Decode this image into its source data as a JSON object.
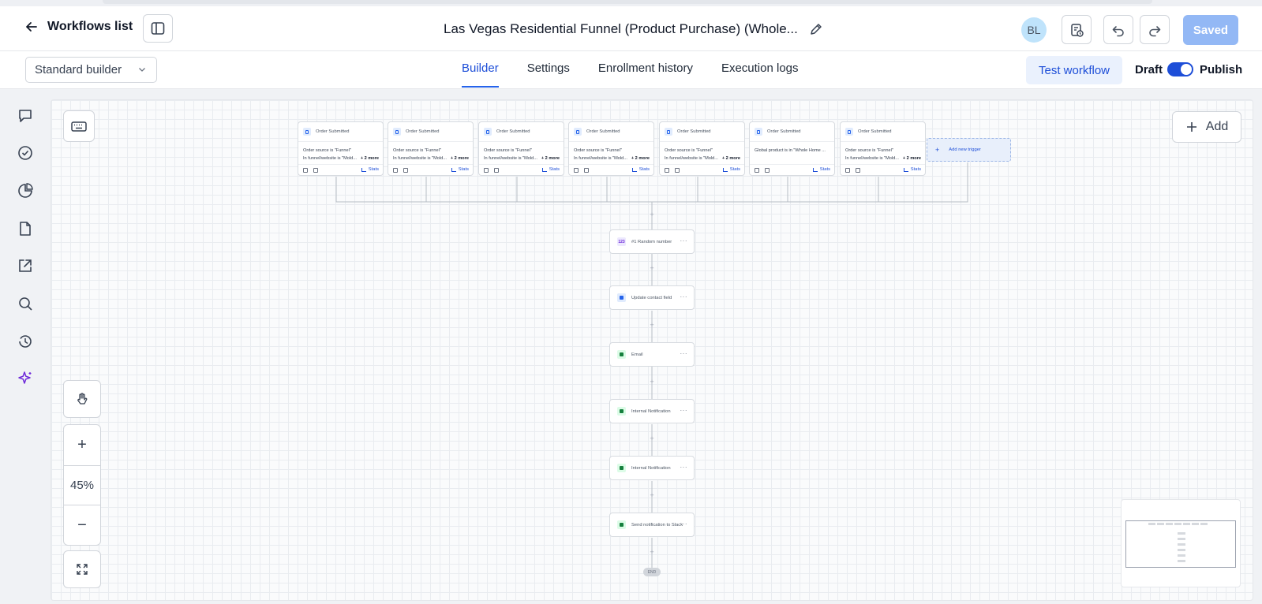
{
  "header": {
    "back_label": "Workflows list",
    "title": "Las Vegas Residential Funnel (Product Purchase) (Whole...",
    "avatar_initials": "BL",
    "saved_label": "Saved"
  },
  "subbar": {
    "builder_select": "Standard builder",
    "tabs": [
      {
        "label": "Builder",
        "active": true
      },
      {
        "label": "Settings",
        "active": false
      },
      {
        "label": "Enrollment history",
        "active": false
      },
      {
        "label": "Execution logs",
        "active": false
      }
    ],
    "test_workflow_label": "Test workflow",
    "draft_label": "Draft",
    "publish_label": "Publish"
  },
  "sidebar": {
    "icons": [
      "chat-icon",
      "check-circle-icon",
      "pie-chart-icon",
      "document-icon",
      "external-link-icon",
      "search-icon",
      "history-icon",
      "sparkle-icon"
    ]
  },
  "canvas": {
    "zoom_level": "45%",
    "zoom_in": "+",
    "zoom_out": "−",
    "add_label": "Add",
    "add_trigger_label": "Add new trigger",
    "end_label": "END",
    "triggers": [
      {
        "title": "Order Submitted",
        "line1": "Order source is \"Funnel\"",
        "line2": "In funnel/website is \"Mold...",
        "more": "+ 2 more",
        "stats": "Stats"
      },
      {
        "title": "Order Submitted",
        "line1": "Order source is \"Funnel\"",
        "line2": "In funnel/website is \"Mold...",
        "more": "+ 2 more",
        "stats": "Stats"
      },
      {
        "title": "Order Submitted",
        "line1": "Order source is \"Funnel\"",
        "line2": "In funnel/website is \"Mold...",
        "more": "+ 2 more",
        "stats": "Stats"
      },
      {
        "title": "Order Submitted",
        "line1": "Order source is \"Funnel\"",
        "line2": "In funnel/website is \"Mold...",
        "more": "+ 2 more",
        "stats": "Stats"
      },
      {
        "title": "Order Submitted",
        "line1": "Order source is \"Funnel\"",
        "line2": "In funnel/website is \"Mold...",
        "more": "+ 2 more",
        "stats": "Stats"
      },
      {
        "title": "Order Submitted",
        "line1": "Global product is in \"Whole Home ...",
        "line2": "",
        "more": "",
        "stats": "Stats"
      },
      {
        "title": "Order Submitted",
        "line1": "Order source is \"Funnel\"",
        "line2": "In funnel/website is \"Mold...",
        "more": "+ 2 more",
        "stats": "Stats"
      }
    ],
    "actions": [
      {
        "label": "#1 Random number",
        "icon": "123",
        "bg": "#ede9fe",
        "fg": "#6d28d9"
      },
      {
        "label": "Update contact field",
        "icon": "user-icon",
        "bg": "#e0ebfd",
        "fg": "#2563eb"
      },
      {
        "label": "Email",
        "icon": "mail-icon",
        "bg": "#dcfce7",
        "fg": "#15803d"
      },
      {
        "label": "Internal Notification",
        "icon": "bell-icon",
        "bg": "#dcfce7",
        "fg": "#15803d"
      },
      {
        "label": "Internal Notification",
        "icon": "bell-icon",
        "bg": "#dcfce7",
        "fg": "#15803d"
      },
      {
        "label": "Send notification to Slack",
        "icon": "slack-icon",
        "bg": "#dcfce7",
        "fg": "#15803d"
      }
    ]
  },
  "colors": {
    "accent": "#1d4ed8",
    "saved_button": "#93b8f5"
  }
}
